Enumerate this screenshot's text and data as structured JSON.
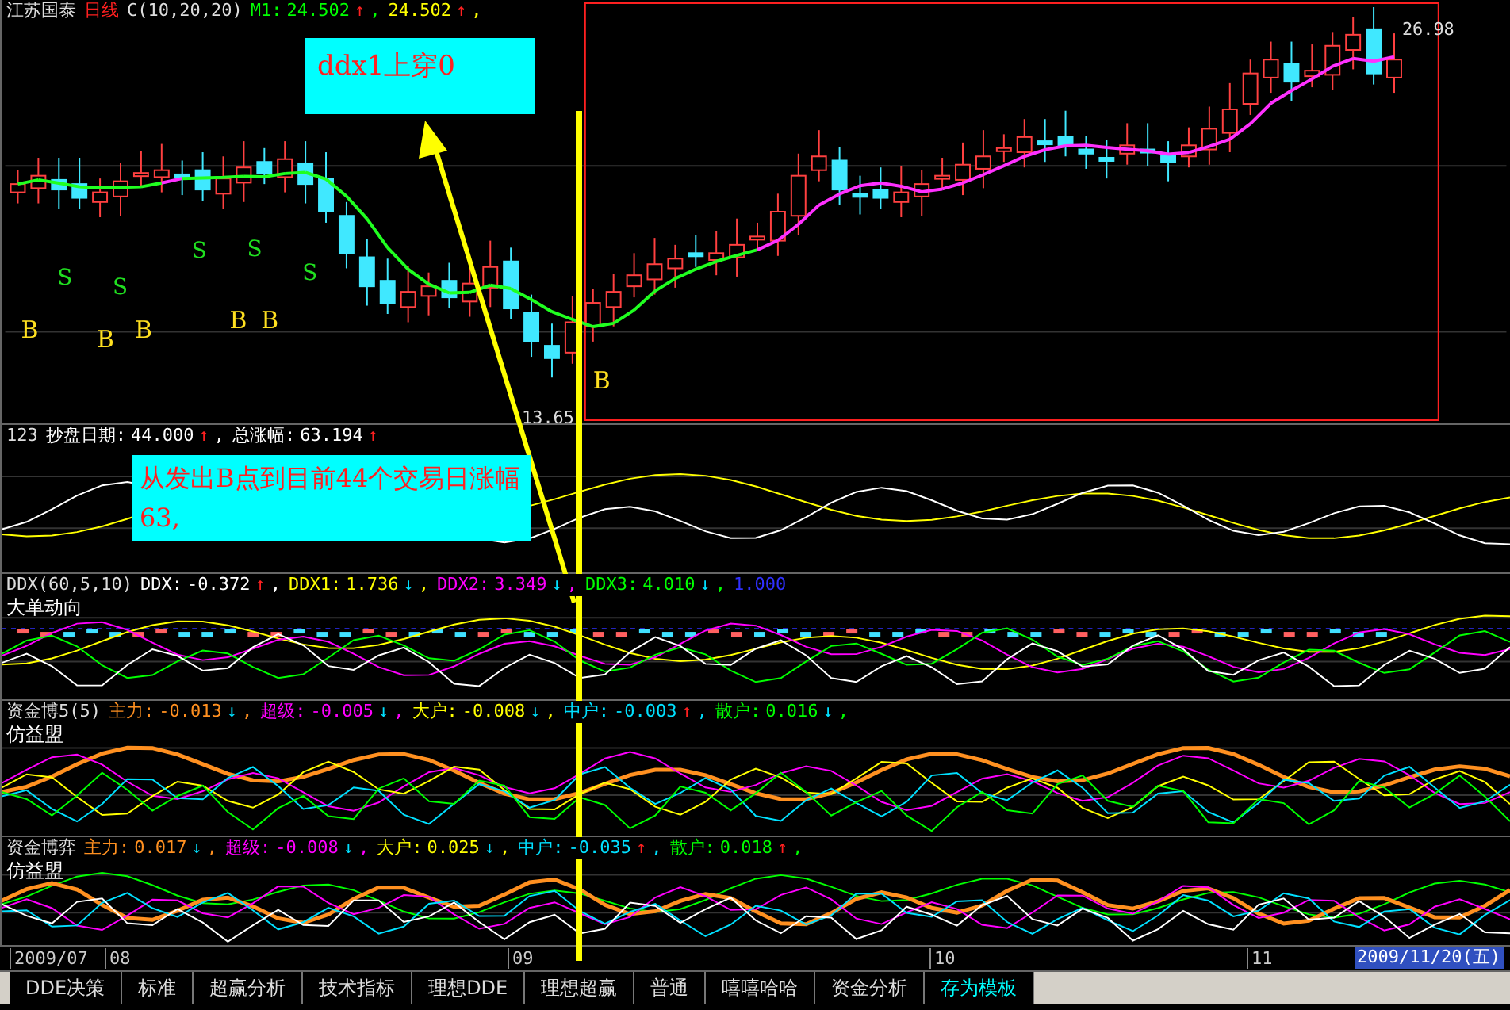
{
  "main": {
    "stock_name": "江苏国泰",
    "period": "日线",
    "indicator": "C(10,20,20)",
    "values": [
      {
        "label": "M1:",
        "value": "24.502",
        "arrow": {
          "text": "↑",
          "color": "#ff2020"
        },
        "suffix": ",",
        "color": "#00ff00"
      },
      {
        "value": "24.502",
        "arrow": {
          "text": "↑",
          "color": "#ff2020"
        },
        "suffix": ",",
        "color": "#ffff00"
      }
    ],
    "signals": [
      {
        "text": "S",
        "kind": "sell"
      },
      {
        "text": "S",
        "kind": "sell"
      },
      {
        "text": "S",
        "kind": "sell"
      },
      {
        "text": "S",
        "kind": "sell"
      },
      {
        "text": "S",
        "kind": "sell"
      },
      {
        "text": "B",
        "kind": "buy"
      },
      {
        "text": "B",
        "kind": "buy"
      },
      {
        "text": "B",
        "kind": "buy"
      },
      {
        "text": "B",
        "kind": "buy"
      },
      {
        "text": "B",
        "kind": "buy"
      },
      {
        "text": "B",
        "kind": "buy"
      }
    ],
    "high_label": "26.98",
    "low_label": "13.65"
  },
  "annotations": [
    {
      "text": "ddx1上穿0"
    },
    {
      "text": "从发出B点到目前44个交易日涨幅63,"
    }
  ],
  "panels": [
    {
      "title": "123",
      "values": [
        {
          "label": "抄盘日期:",
          "value": "44.000",
          "arrow": {
            "text": "↑",
            "color": "#ff2020"
          },
          "suffix": ",",
          "color": "#ffffff"
        },
        {
          "label": "总涨幅:",
          "value": "63.194",
          "arrow": {
            "text": "↑",
            "color": "#ff2020"
          },
          "color": "#ffffff"
        }
      ]
    },
    {
      "title": "DDX(60,5,10)",
      "subtitle": "大单动向",
      "values": [
        {
          "label": "DDX:",
          "value": "-0.372",
          "arrow": {
            "text": "↑",
            "color": "#ff2020"
          },
          "suffix": ",",
          "color": "#ffffff"
        },
        {
          "label": "DDX1:",
          "value": "1.736",
          "arrow": {
            "text": "↓",
            "color": "#00e0ff"
          },
          "suffix": ",",
          "color": "#ffff00"
        },
        {
          "label": "DDX2:",
          "value": "3.349",
          "arrow": {
            "text": "↓",
            "color": "#00e0ff"
          },
          "suffix": ",",
          "color": "#ff00ff"
        },
        {
          "label": "DDX3:",
          "value": "4.010",
          "arrow": {
            "text": "↓",
            "color": "#00e0ff"
          },
          "suffix": ",",
          "color": "#00ff00"
        },
        {
          "value": "1.000",
          "color": "#3030ff"
        }
      ]
    },
    {
      "title": "资金博5(5)",
      "subtitle": "仿益盟",
      "values": [
        {
          "label": "主力:",
          "value": "-0.013",
          "arrow": {
            "text": "↓",
            "color": "#00e0ff"
          },
          "suffix": ",",
          "color": "#ff9020"
        },
        {
          "label": "超级:",
          "value": "-0.005",
          "arrow": {
            "text": "↓",
            "color": "#00e0ff"
          },
          "suffix": ",",
          "color": "#ff00ff"
        },
        {
          "label": "大户:",
          "value": "-0.008",
          "arrow": {
            "text": "↓",
            "color": "#00e0ff"
          },
          "suffix": ",",
          "color": "#ffff00"
        },
        {
          "label": "中户:",
          "value": "-0.003",
          "arrow": {
            "text": "↑",
            "color": "#ff2020"
          },
          "suffix": ",",
          "color": "#00e0ff"
        },
        {
          "label": "散户:",
          "value": "0.016",
          "arrow": {
            "text": "↓",
            "color": "#00e0ff"
          },
          "suffix": ",",
          "color": "#00ff00"
        }
      ]
    },
    {
      "title": "资金博弈",
      "subtitle": "仿益盟",
      "values": [
        {
          "label": "主力:",
          "value": "0.017",
          "arrow": {
            "text": "↓",
            "color": "#00e0ff"
          },
          "suffix": ",",
          "color": "#ff9020"
        },
        {
          "label": "超级:",
          "value": "-0.008",
          "arrow": {
            "text": "↓",
            "color": "#00e0ff"
          },
          "suffix": ",",
          "color": "#ff00ff"
        },
        {
          "label": "大户:",
          "value": "0.025",
          "arrow": {
            "text": "↓",
            "color": "#00e0ff"
          },
          "suffix": ",",
          "color": "#ffff00"
        },
        {
          "label": "中户:",
          "value": "-0.035",
          "arrow": {
            "text": "↑",
            "color": "#ff2020"
          },
          "suffix": ",",
          "color": "#00e0ff"
        },
        {
          "label": "散户:",
          "value": "0.018",
          "arrow": {
            "text": "↑",
            "color": "#ff2020"
          },
          "suffix": ",",
          "color": "#00ff00"
        }
      ]
    }
  ],
  "time_axis": {
    "labels": [
      "2009/07",
      "08",
      "09",
      "10",
      "11"
    ],
    "current_date": "2009/11/20(五)"
  },
  "tabs": [
    {
      "label": "DDE决策",
      "selected": false
    },
    {
      "label": "标准",
      "selected": false
    },
    {
      "label": "超赢分析",
      "selected": false
    },
    {
      "label": "技术指标",
      "selected": false
    },
    {
      "label": "理想DDE",
      "selected": false
    },
    {
      "label": "理想超赢",
      "selected": false
    },
    {
      "label": "普通",
      "selected": false
    },
    {
      "label": "嘻嘻哈哈",
      "selected": false
    },
    {
      "label": "资金分析",
      "selected": false
    },
    {
      "label": "存为模板",
      "selected": true
    }
  ]
}
